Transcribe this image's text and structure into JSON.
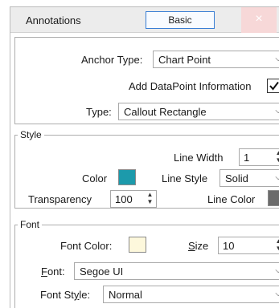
{
  "window": {
    "title": "Annotations",
    "mode_button": "Basic",
    "close_glyph": "×"
  },
  "general": {
    "anchor_type_label": "Anchor Type:",
    "anchor_type_value": "Chart Point",
    "add_datapoint_label": "Add DataPoint Information",
    "add_datapoint_checked": true,
    "type_label": "Type:",
    "type_value": "Callout Rectangle"
  },
  "style": {
    "legend": "Style",
    "line_width_label": "Line Width",
    "line_width_value": "1",
    "color_label": "Color",
    "color_value": "#1c9aab",
    "line_style_label": "Line Style",
    "line_style_value": "Solid",
    "transparency_label": "Transparency",
    "transparency_value": "100",
    "line_color_label": "Line Color",
    "line_color_value": "#6b6b6b"
  },
  "font": {
    "legend": "Font",
    "font_color_label": "Font Color:",
    "font_color_value": "#fdf8dc",
    "size_label_prefix": "S",
    "size_label_rest": "ize",
    "size_value": "10",
    "font_label_prefix": "F",
    "font_label_rest": "ont:",
    "font_value": "Segoe UI",
    "font_style_label_prefix": "Font St",
    "font_style_label_underlined": "y",
    "font_style_label_rest": "le:",
    "font_style_value": "Normal"
  },
  "icons": {
    "dropdown": "chevron-down-icon",
    "spinner": "spin-updown-icon",
    "close": "close-icon"
  }
}
